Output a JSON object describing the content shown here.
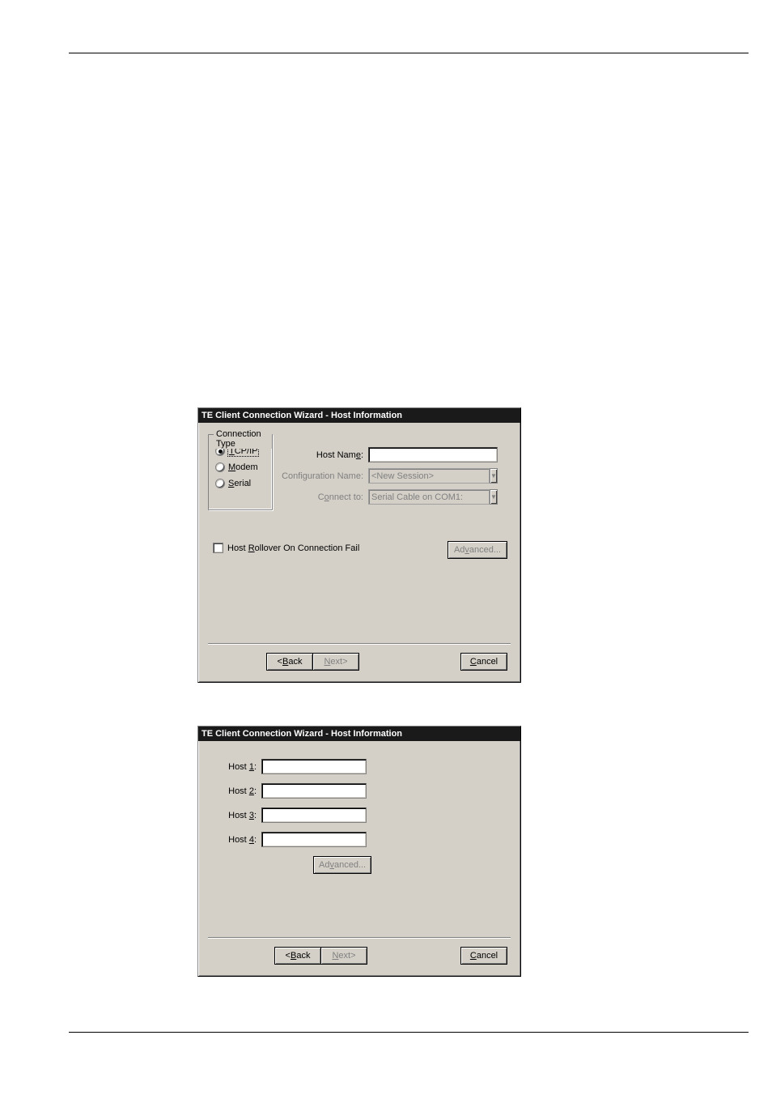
{
  "dialog1": {
    "title": "TE Client Connection Wizard - Host Information",
    "connection_type_legend": "Connection Type",
    "radios": {
      "tcpip": "TCP/IP",
      "modem": "Modem",
      "serial": "Serial"
    },
    "host_name_label": "Host Name:",
    "host_name_value": "",
    "config_name_label": "Configuration Name:",
    "config_name_value": "<New Session>",
    "connect_to_label": "Connect to:",
    "connect_to_value": "Serial Cable on COM1:",
    "rollover_label": "Host Rollover On Connection Fail",
    "advanced_label": "Advanced...",
    "back_label": "<Back",
    "next_label": "Next>",
    "cancel_label": "Cancel"
  },
  "dialog2": {
    "title": "TE Client Connection Wizard - Host Information",
    "host1_label": "Host 1:",
    "host2_label": "Host 2:",
    "host3_label": "Host 3:",
    "host4_label": "Host 4:",
    "host1_value": "",
    "host2_value": "",
    "host3_value": "",
    "host4_value": "",
    "advanced_label": "Advanced...",
    "back_label": "<Back",
    "next_label": "Next>",
    "cancel_label": "Cancel"
  }
}
